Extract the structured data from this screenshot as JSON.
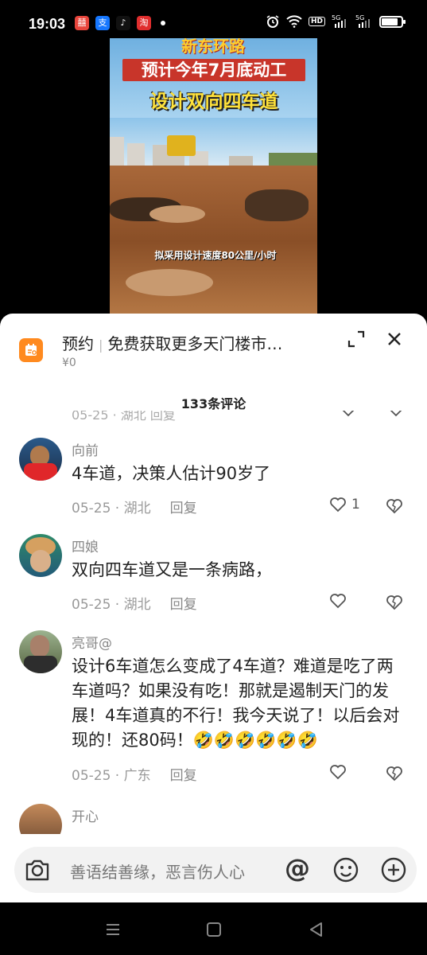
{
  "status": {
    "time": "19:03",
    "apps": [
      {
        "icon": "red-app-icon",
        "label": "囍",
        "color": "#e8453c"
      },
      {
        "icon": "alipay-icon",
        "label": "支",
        "color": "#1677ff"
      },
      {
        "icon": "tiktok-icon",
        "label": "♪",
        "color": "#111111"
      },
      {
        "icon": "shopping-app-icon",
        "label": "淘",
        "color": "#e02e2e"
      }
    ],
    "network_labels": [
      "HD",
      "5G",
      "5G"
    ]
  },
  "video": {
    "top_text": "新东环路",
    "banner_red": "预计今年7月底动工",
    "banner_yellow": "设计双向四车道",
    "caption": "拟采用设计速度80公里/小时"
  },
  "ad": {
    "tag": "预约",
    "title": "免费获取更多天门楼市…",
    "price": "¥0"
  },
  "comment_count": "133条评论",
  "ghost_meta": "05-25 · 湖北    回复",
  "comments": [
    {
      "name": "向前",
      "text": "4车道，决策人估计90岁了",
      "date": "05-25 · 湖北",
      "reply": "回复",
      "likes": "1"
    },
    {
      "name": "四娘",
      "text": "双向四车道又是一条病路，",
      "date": "05-25 · 湖北",
      "reply": "回复",
      "likes": ""
    },
    {
      "name": "亮哥@",
      "text": "设计6车道怎么变成了4车道？难道是吃了两车道吗？如果没有吃！那就是遏制天门的发展！4车道真的不行！我今天说了！以后会对现的！还80码！🤣🤣🤣🤣🤣🤣",
      "date": "05-25 · 广东",
      "reply": "回复",
      "likes": ""
    },
    {
      "name": "开心",
      "text": "",
      "date": "",
      "reply": "",
      "likes": ""
    }
  ],
  "input": {
    "placeholder": "善语结善缘，恶言伤人心",
    "at_symbol": "@"
  }
}
